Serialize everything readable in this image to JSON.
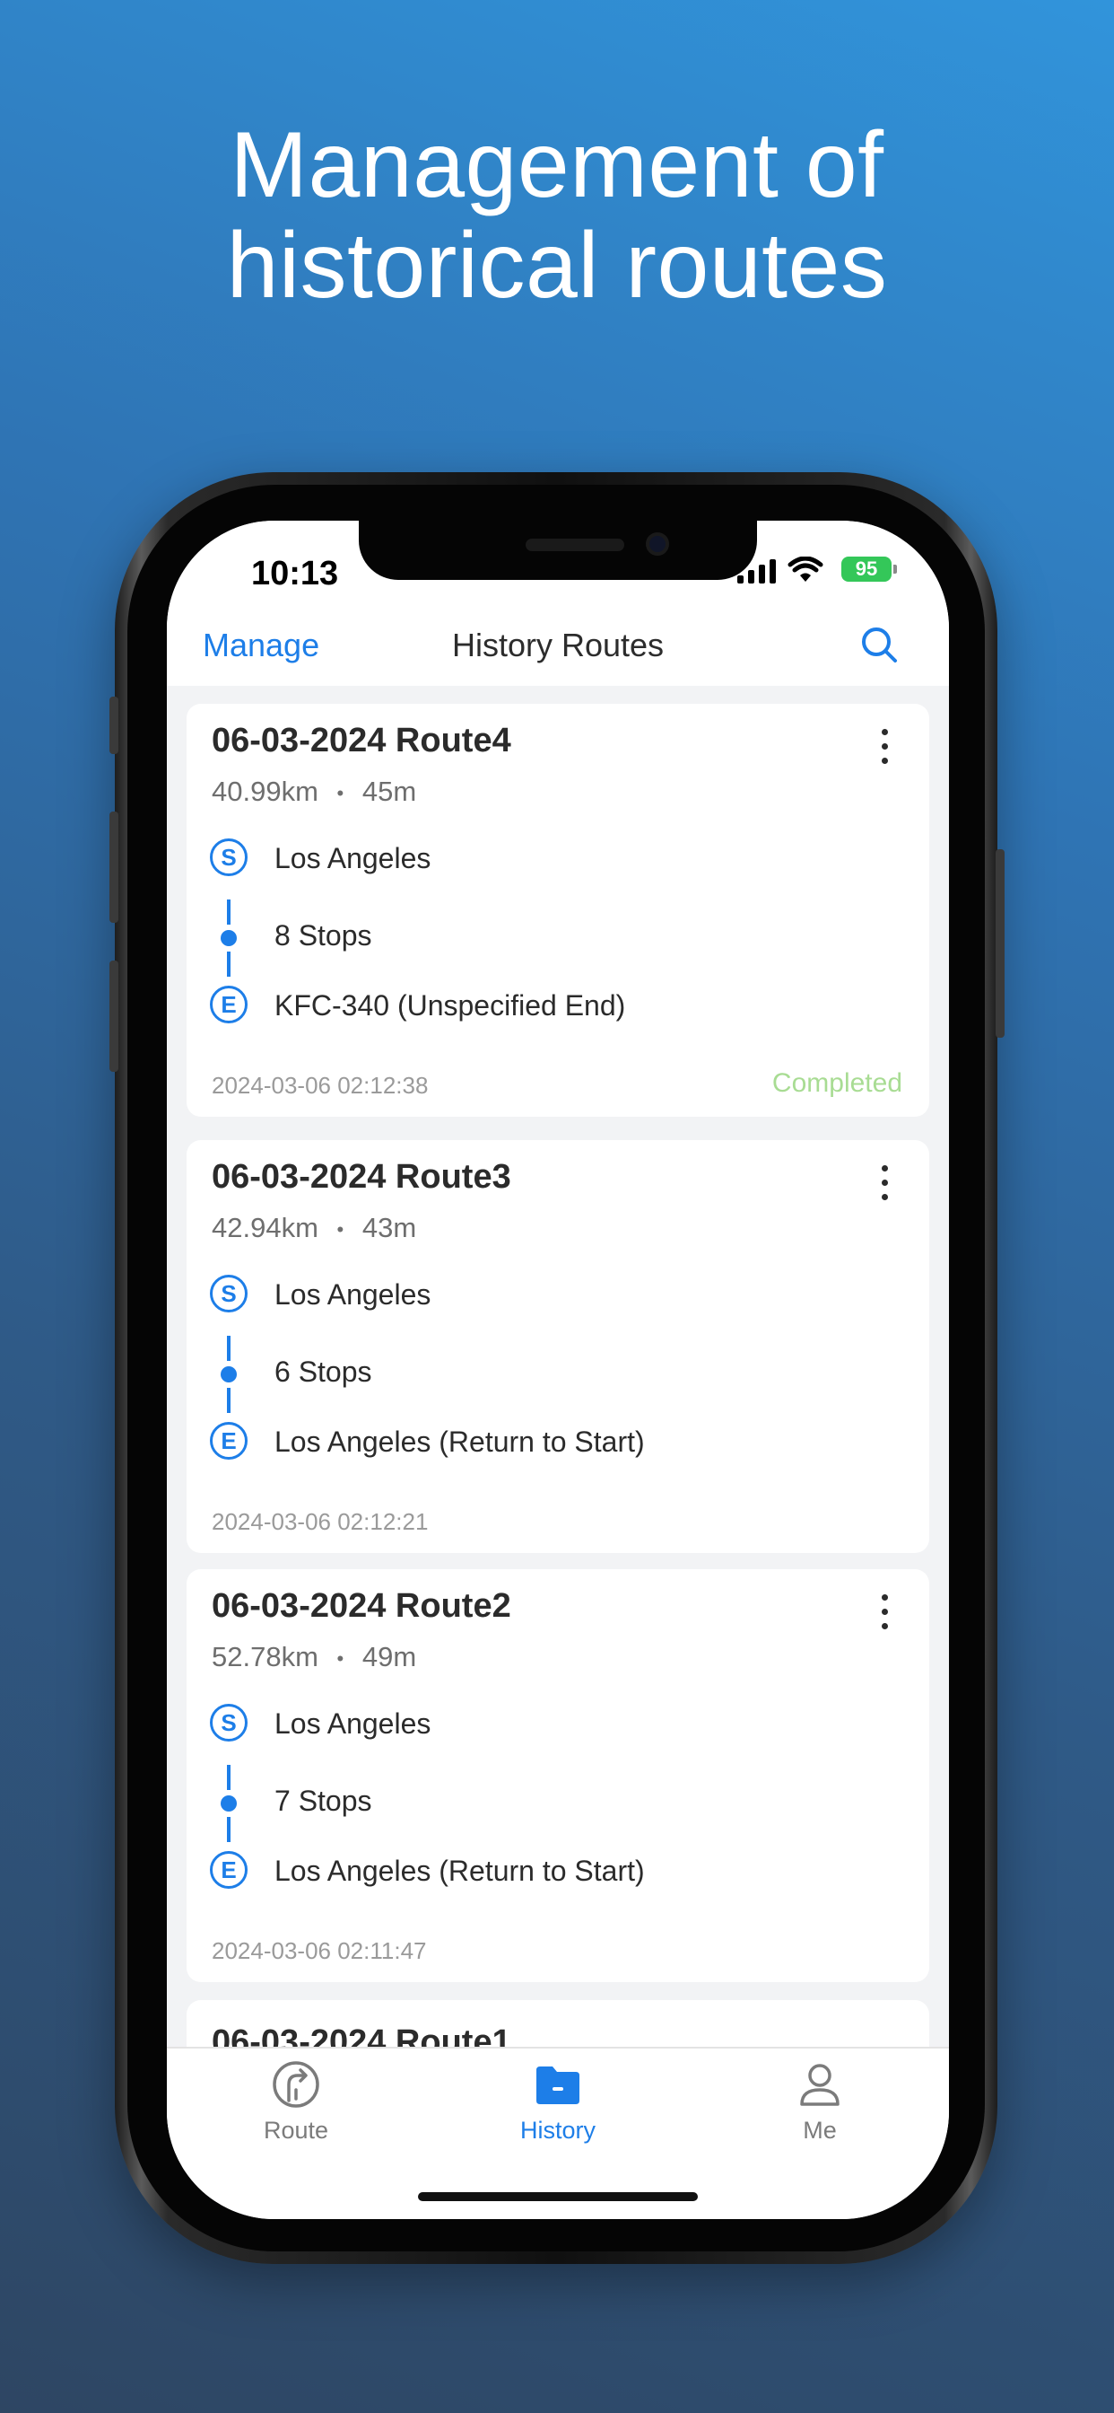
{
  "headline": {
    "line1": "Management of",
    "line2": "historical routes"
  },
  "status_bar": {
    "time": "10:13",
    "battery": "95"
  },
  "nav": {
    "manage_label": "Manage",
    "title": "History Routes"
  },
  "routes": [
    {
      "title": "06-03-2024 Route4",
      "distance": "40.99km",
      "duration": "45m",
      "start_badge": "S",
      "start": "Los Angeles",
      "stops": "8 Stops",
      "end_badge": "E",
      "end": "KFC-340 (Unspecified End)",
      "date": "2024-03-06 02:12:38",
      "status": "Completed"
    },
    {
      "title": "06-03-2024 Route3",
      "distance": "42.94km",
      "duration": "43m",
      "start_badge": "S",
      "start": "Los Angeles",
      "stops": "6 Stops",
      "end_badge": "E",
      "end": "Los Angeles (Return to Start)",
      "date": "2024-03-06 02:12:21"
    },
    {
      "title": "06-03-2024 Route2",
      "distance": "52.78km",
      "duration": "49m",
      "start_badge": "S",
      "start": "Los Angeles",
      "stops": "7 Stops",
      "end_badge": "E",
      "end": "Los Angeles (Return to Start)",
      "date": "2024-03-06 02:11:47"
    }
  ],
  "partial_card_title": "06-03-2024 Route1",
  "meta_separator": "•",
  "tabs": [
    {
      "label": "Route",
      "icon": "route-icon"
    },
    {
      "label": "History",
      "icon": "folder-icon",
      "active": true
    },
    {
      "label": "Me",
      "icon": "person-icon"
    }
  ],
  "colors": {
    "accent": "#1d7ee8",
    "completed": "#a8dc93",
    "battery": "#34c759"
  }
}
